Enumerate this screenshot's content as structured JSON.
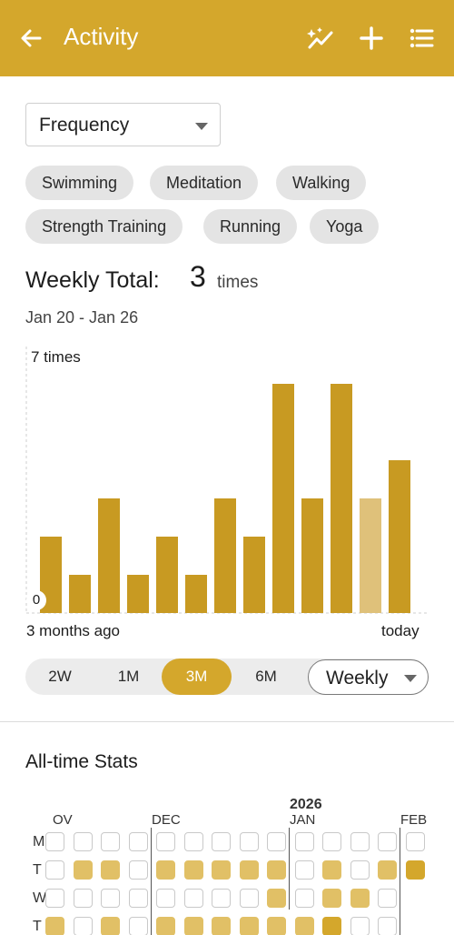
{
  "header": {
    "title": "Activity",
    "back_icon": "arrow-left-icon",
    "actions": [
      "trend-sparkle-icon",
      "plus-icon",
      "list-icon"
    ],
    "background": "#d4a72c"
  },
  "filter": {
    "selected": "Frequency"
  },
  "activities": [
    "Swimming",
    "Meditation",
    "Walking",
    "Strength Training",
    "Running",
    "Yoga"
  ],
  "weekly_total": {
    "label": "Weekly Total:",
    "value": "3",
    "unit": "times",
    "range": "Jan 20 - Jan 26"
  },
  "chart_data": {
    "type": "bar",
    "y_max_label": "7 times",
    "y_min_label": "0",
    "x_start_label": "3 months ago",
    "x_end_label": "today",
    "ylim": [
      0,
      7
    ],
    "values": [
      2,
      1,
      3,
      1,
      2,
      1,
      3,
      2,
      6,
      3,
      6,
      3,
      4
    ],
    "highlight_index": 11,
    "colors": {
      "bar": "#c89a22",
      "highlight": "#dfc17a"
    }
  },
  "range_tabs": {
    "options": [
      "2W",
      "1M",
      "3M",
      "6M"
    ],
    "active": "3M",
    "period": "Weekly"
  },
  "stats": {
    "title": "All-time Stats",
    "year": "2026",
    "months": [
      "OV",
      "DEC",
      "JAN",
      "FEB"
    ],
    "days": [
      "M",
      "T",
      "W",
      "T"
    ],
    "grid": [
      [
        0,
        0,
        0,
        0,
        0,
        0,
        0,
        0,
        0,
        0,
        0,
        0,
        0,
        0
      ],
      [
        0,
        1,
        1,
        0,
        1,
        1,
        1,
        1,
        1,
        0,
        1,
        0,
        1,
        2
      ],
      [
        0,
        0,
        0,
        0,
        0,
        0,
        0,
        0,
        1,
        0,
        1,
        1,
        0,
        -1
      ],
      [
        1,
        0,
        1,
        0,
        1,
        1,
        1,
        1,
        1,
        1,
        2,
        0,
        0,
        -1
      ]
    ]
  }
}
